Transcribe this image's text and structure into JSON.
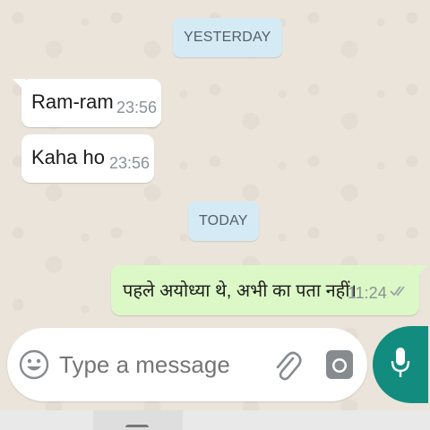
{
  "dates": {
    "yesterday": "YESTERDAY",
    "today": "TODAY"
  },
  "messages": [
    {
      "direction": "incoming",
      "text": "Ram-ram",
      "time": "23:56"
    },
    {
      "direction": "incoming",
      "text": "Kaha ho",
      "time": "23:56"
    },
    {
      "direction": "outgoing",
      "text": "पहले अयोध्या थे, अभी का पता नहीं।",
      "time": "11:24",
      "status_icon": "double-check-icon"
    }
  ],
  "composer": {
    "placeholder": "Type a message",
    "icons": [
      "emoji-icon",
      "paperclip-icon",
      "camera-icon",
      "microphone-icon"
    ]
  },
  "colors": {
    "incoming_bubble": "#ffffff",
    "outgoing_bubble": "#dcf8c6",
    "date_chip": "#d4eaf4",
    "mic_button": "#128c7e"
  }
}
